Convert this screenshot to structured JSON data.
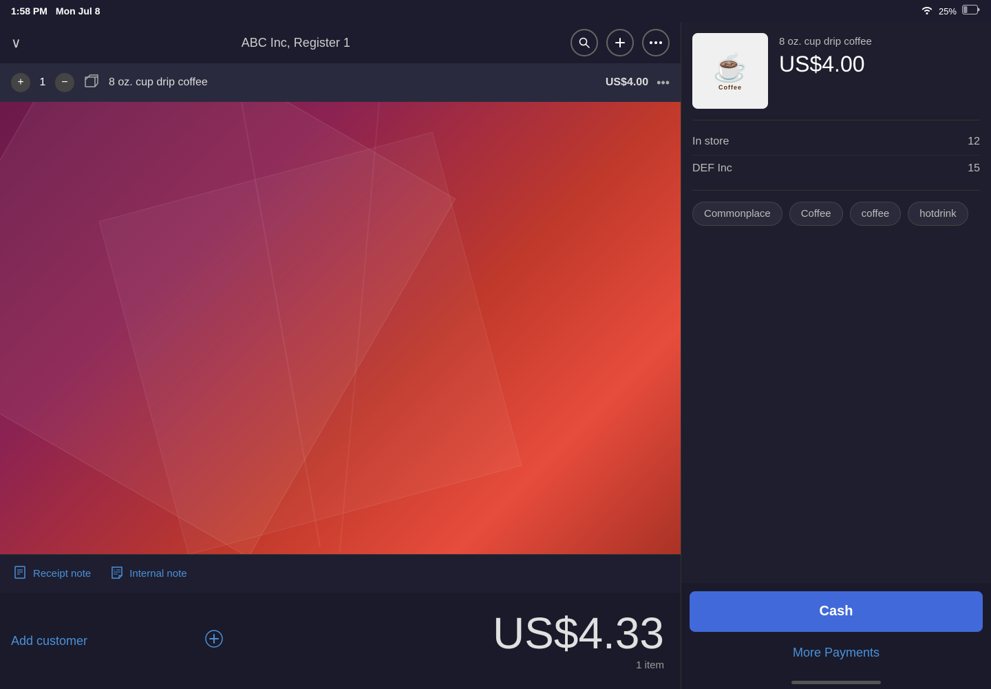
{
  "statusBar": {
    "time": "1:58 PM",
    "date": "Mon Jul 8",
    "wifi": "WiFi",
    "battery": "25%"
  },
  "header": {
    "dropdownArrow": "∨",
    "title": "ABC Inc, Register 1",
    "searchLabel": "Search",
    "addLabel": "Add",
    "moreLabel": "More"
  },
  "cartItem": {
    "quantity": "1",
    "name": "8 oz. cup drip coffee",
    "price": "US$4.00"
  },
  "notes": {
    "receiptNote": "Receipt note",
    "internalNote": "Internal note"
  },
  "footer": {
    "addCustomer": "Add customer",
    "totalAmount": "US$4.33",
    "itemCount": "1 item"
  },
  "productDetail": {
    "imageName": "Coffee",
    "name": "8 oz. cup drip coffee",
    "price": "US$4.00",
    "stock": [
      {
        "label": "In store",
        "value": "12"
      },
      {
        "label": "DEF Inc",
        "value": "15"
      }
    ],
    "tags": [
      "Commonplace",
      "Coffee",
      "coffee",
      "hotdrink"
    ]
  },
  "payment": {
    "cashLabel": "Cash",
    "morePaymentsLabel": "More Payments"
  }
}
